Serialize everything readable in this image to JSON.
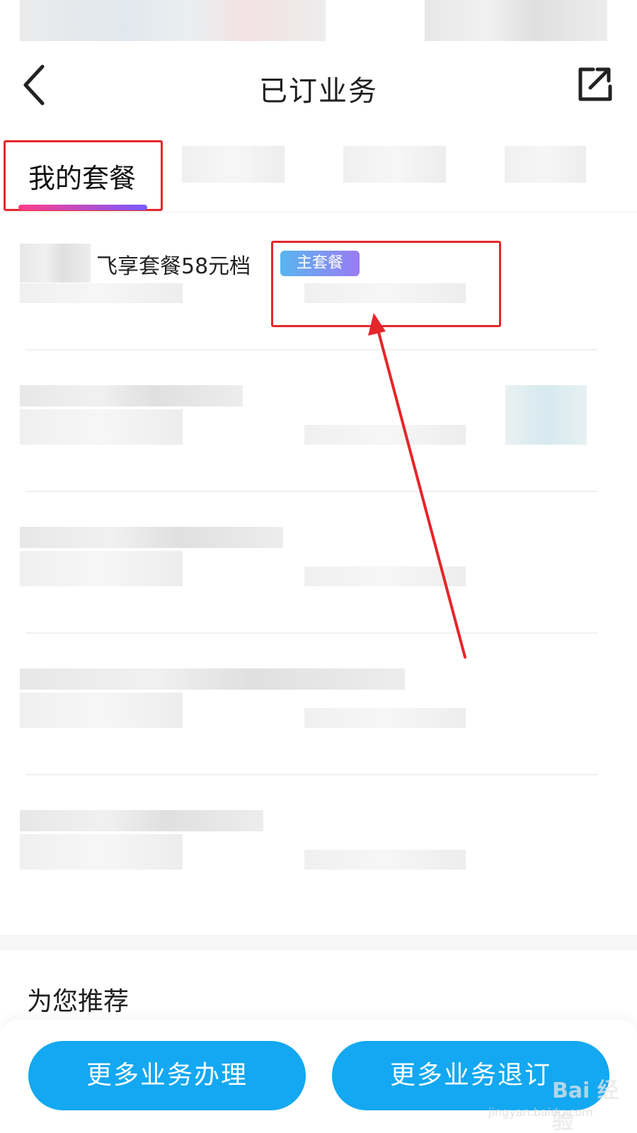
{
  "header": {
    "title": "已订业务"
  },
  "tabs": {
    "mine_label": "我的套餐"
  },
  "plan": {
    "name": "飞享套餐58元档",
    "tag": "主套餐"
  },
  "recommend": {
    "title": "为您推荐"
  },
  "buttons": {
    "more_apply": "更多业务办理",
    "more_unsubscribe": "更多业务退订"
  },
  "watermark": {
    "text": "Bai 经验",
    "sub": "jingyan.baidu.com"
  },
  "colors": {
    "accent_blue": "#13a8f1",
    "annotation_red": "#e5262a",
    "tab_underline": [
      "#ff3d8a",
      "#7a5cff"
    ]
  },
  "icons": {
    "back": "chevron-left-icon",
    "share": "share-icon"
  }
}
